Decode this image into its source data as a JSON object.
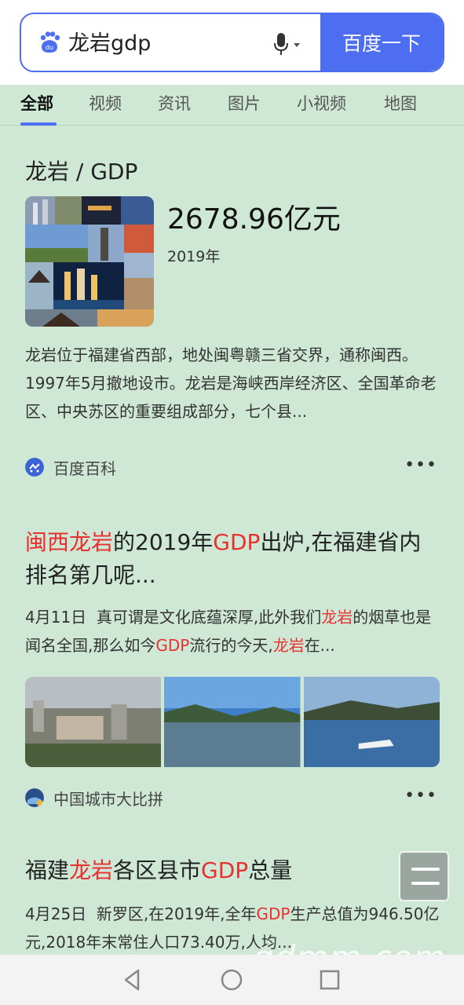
{
  "search": {
    "query": "龙岩gdp",
    "button_label": "百度一下"
  },
  "tabs": [
    {
      "label": "全部",
      "active": true
    },
    {
      "label": "视频"
    },
    {
      "label": "资讯"
    },
    {
      "label": "图片"
    },
    {
      "label": "小视频"
    },
    {
      "label": "地图"
    }
  ],
  "knowledge_card": {
    "title": "龙岩 / GDP",
    "value": "2678.96亿元",
    "year": "2019年",
    "description": "龙岩位于福建省西部，地处闽粤赣三省交界，通称闽西。1997年5月撤地设市。龙岩是海峡西岸经济区、全国革命老区、中央苏区的重要组成部分，七个县...",
    "source": "百度百科"
  },
  "result1": {
    "title_parts": [
      "闽西龙岩",
      "的2019年",
      "GDP",
      "出炉,在福建省内排名第几呢..."
    ],
    "snippet_date": "4月11日",
    "snippet_parts": [
      "真可谓是文化底蕴深厚,此外我们",
      "龙岩",
      "的烟草也是闻名全国,那么如今",
      "GDP",
      "流行的今天,",
      "龙岩",
      "在..."
    ],
    "source": "中国城市大比拼"
  },
  "result2": {
    "title_parts": [
      "福建",
      "龙岩",
      "各区县市",
      "GDP",
      "总量"
    ],
    "snippet_date": "4月25日",
    "snippet_parts": [
      "新罗区,在2019年,全年",
      "GDP",
      "生产总值为946.50亿元,2018年末常住人口73.40万,人均..."
    ]
  },
  "more_label": "•••",
  "watermark": "gdmm.com",
  "colors": {
    "accent": "#4e6ef2",
    "highlight": "#e8312f",
    "background": "#cfe8d6"
  }
}
